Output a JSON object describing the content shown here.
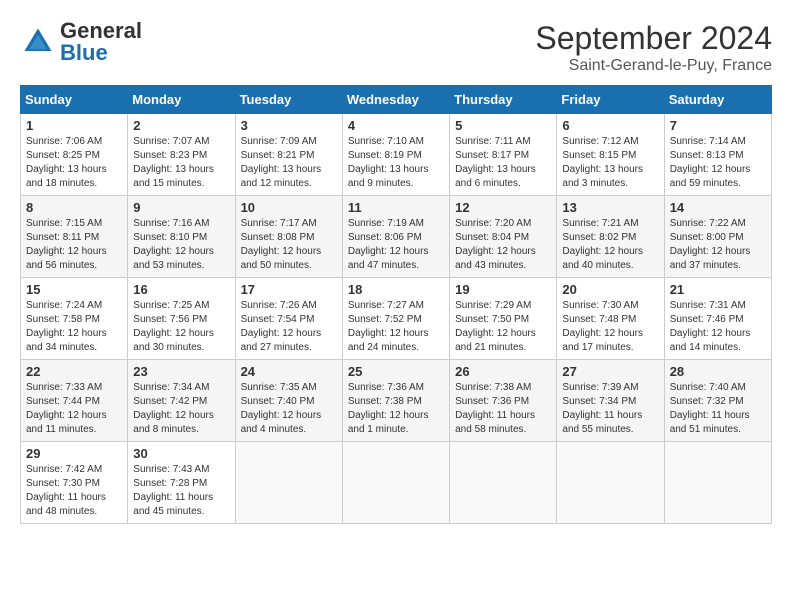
{
  "header": {
    "logo_general": "General",
    "logo_blue": "Blue",
    "month_title": "September 2024",
    "location": "Saint-Gerand-le-Puy, France"
  },
  "weekdays": [
    "Sunday",
    "Monday",
    "Tuesday",
    "Wednesday",
    "Thursday",
    "Friday",
    "Saturday"
  ],
  "weeks": [
    [
      {
        "day": "1",
        "info": "Sunrise: 7:06 AM\nSunset: 8:25 PM\nDaylight: 13 hours\nand 18 minutes."
      },
      {
        "day": "2",
        "info": "Sunrise: 7:07 AM\nSunset: 8:23 PM\nDaylight: 13 hours\nand 15 minutes."
      },
      {
        "day": "3",
        "info": "Sunrise: 7:09 AM\nSunset: 8:21 PM\nDaylight: 13 hours\nand 12 minutes."
      },
      {
        "day": "4",
        "info": "Sunrise: 7:10 AM\nSunset: 8:19 PM\nDaylight: 13 hours\nand 9 minutes."
      },
      {
        "day": "5",
        "info": "Sunrise: 7:11 AM\nSunset: 8:17 PM\nDaylight: 13 hours\nand 6 minutes."
      },
      {
        "day": "6",
        "info": "Sunrise: 7:12 AM\nSunset: 8:15 PM\nDaylight: 13 hours\nand 3 minutes."
      },
      {
        "day": "7",
        "info": "Sunrise: 7:14 AM\nSunset: 8:13 PM\nDaylight: 12 hours\nand 59 minutes."
      }
    ],
    [
      {
        "day": "8",
        "info": "Sunrise: 7:15 AM\nSunset: 8:11 PM\nDaylight: 12 hours\nand 56 minutes."
      },
      {
        "day": "9",
        "info": "Sunrise: 7:16 AM\nSunset: 8:10 PM\nDaylight: 12 hours\nand 53 minutes."
      },
      {
        "day": "10",
        "info": "Sunrise: 7:17 AM\nSunset: 8:08 PM\nDaylight: 12 hours\nand 50 minutes."
      },
      {
        "day": "11",
        "info": "Sunrise: 7:19 AM\nSunset: 8:06 PM\nDaylight: 12 hours\nand 47 minutes."
      },
      {
        "day": "12",
        "info": "Sunrise: 7:20 AM\nSunset: 8:04 PM\nDaylight: 12 hours\nand 43 minutes."
      },
      {
        "day": "13",
        "info": "Sunrise: 7:21 AM\nSunset: 8:02 PM\nDaylight: 12 hours\nand 40 minutes."
      },
      {
        "day": "14",
        "info": "Sunrise: 7:22 AM\nSunset: 8:00 PM\nDaylight: 12 hours\nand 37 minutes."
      }
    ],
    [
      {
        "day": "15",
        "info": "Sunrise: 7:24 AM\nSunset: 7:58 PM\nDaylight: 12 hours\nand 34 minutes."
      },
      {
        "day": "16",
        "info": "Sunrise: 7:25 AM\nSunset: 7:56 PM\nDaylight: 12 hours\nand 30 minutes."
      },
      {
        "day": "17",
        "info": "Sunrise: 7:26 AM\nSunset: 7:54 PM\nDaylight: 12 hours\nand 27 minutes."
      },
      {
        "day": "18",
        "info": "Sunrise: 7:27 AM\nSunset: 7:52 PM\nDaylight: 12 hours\nand 24 minutes."
      },
      {
        "day": "19",
        "info": "Sunrise: 7:29 AM\nSunset: 7:50 PM\nDaylight: 12 hours\nand 21 minutes."
      },
      {
        "day": "20",
        "info": "Sunrise: 7:30 AM\nSunset: 7:48 PM\nDaylight: 12 hours\nand 17 minutes."
      },
      {
        "day": "21",
        "info": "Sunrise: 7:31 AM\nSunset: 7:46 PM\nDaylight: 12 hours\nand 14 minutes."
      }
    ],
    [
      {
        "day": "22",
        "info": "Sunrise: 7:33 AM\nSunset: 7:44 PM\nDaylight: 12 hours\nand 11 minutes."
      },
      {
        "day": "23",
        "info": "Sunrise: 7:34 AM\nSunset: 7:42 PM\nDaylight: 12 hours\nand 8 minutes."
      },
      {
        "day": "24",
        "info": "Sunrise: 7:35 AM\nSunset: 7:40 PM\nDaylight: 12 hours\nand 4 minutes."
      },
      {
        "day": "25",
        "info": "Sunrise: 7:36 AM\nSunset: 7:38 PM\nDaylight: 12 hours\nand 1 minute."
      },
      {
        "day": "26",
        "info": "Sunrise: 7:38 AM\nSunset: 7:36 PM\nDaylight: 11 hours\nand 58 minutes."
      },
      {
        "day": "27",
        "info": "Sunrise: 7:39 AM\nSunset: 7:34 PM\nDaylight: 11 hours\nand 55 minutes."
      },
      {
        "day": "28",
        "info": "Sunrise: 7:40 AM\nSunset: 7:32 PM\nDaylight: 11 hours\nand 51 minutes."
      }
    ],
    [
      {
        "day": "29",
        "info": "Sunrise: 7:42 AM\nSunset: 7:30 PM\nDaylight: 11 hours\nand 48 minutes."
      },
      {
        "day": "30",
        "info": "Sunrise: 7:43 AM\nSunset: 7:28 PM\nDaylight: 11 hours\nand 45 minutes."
      },
      {
        "day": "",
        "info": ""
      },
      {
        "day": "",
        "info": ""
      },
      {
        "day": "",
        "info": ""
      },
      {
        "day": "",
        "info": ""
      },
      {
        "day": "",
        "info": ""
      }
    ]
  ]
}
